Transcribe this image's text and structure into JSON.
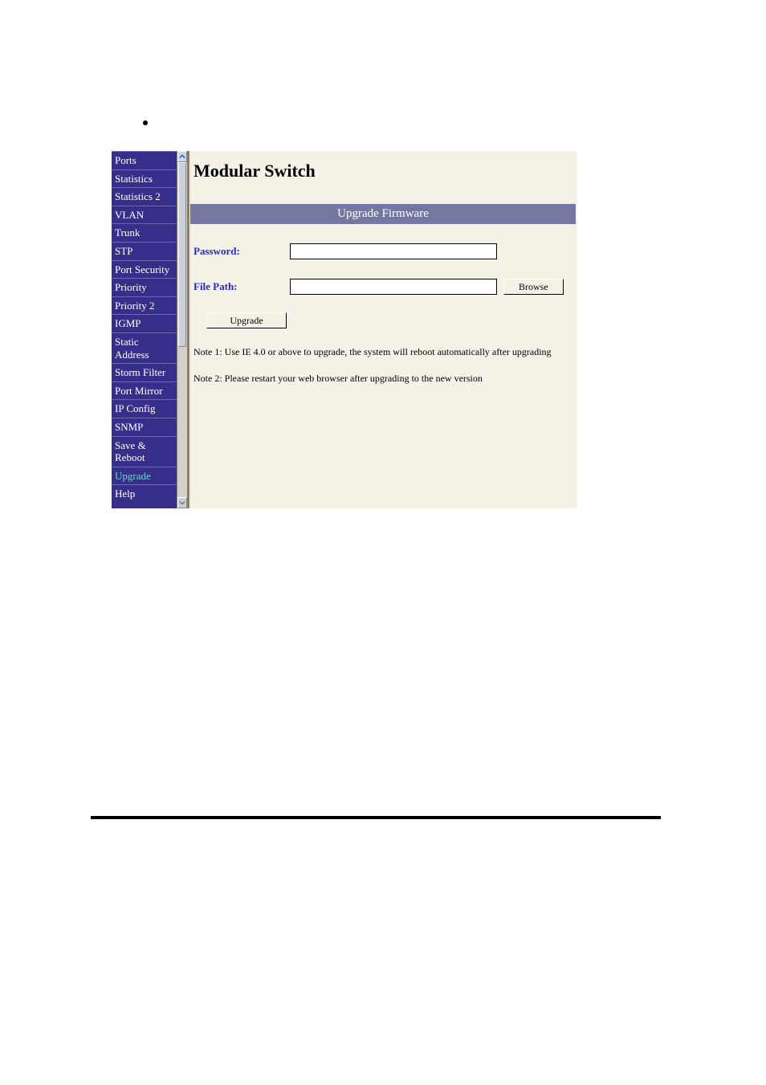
{
  "sidebar": {
    "items": [
      {
        "label": "Ports"
      },
      {
        "label": "Statistics"
      },
      {
        "label": "Statistics 2"
      },
      {
        "label": "VLAN"
      },
      {
        "label": "Trunk"
      },
      {
        "label": "STP"
      },
      {
        "label": "Port Security"
      },
      {
        "label": "Priority"
      },
      {
        "label": "Priority 2"
      },
      {
        "label": "IGMP"
      },
      {
        "label": "Static Address"
      },
      {
        "label": "Storm Filter"
      },
      {
        "label": "Port Mirror"
      },
      {
        "label": "IP Config"
      },
      {
        "label": "SNMP"
      },
      {
        "label": "Save & Reboot"
      },
      {
        "label": "Upgrade"
      },
      {
        "label": "Help"
      }
    ]
  },
  "main": {
    "title": "Modular Switch",
    "panel_header": "Upgrade Firmware",
    "password_label": "Password:",
    "password_value": "",
    "filepath_label": "File Path:",
    "filepath_value": "",
    "browse_label": "Browse",
    "upgrade_label": "Upgrade",
    "note1": "Note 1: Use IE 4.0 or above to upgrade, the system will reboot automatically after upgrading",
    "note2": "Note 2: Please restart your web browser after upgrading to the new version"
  }
}
